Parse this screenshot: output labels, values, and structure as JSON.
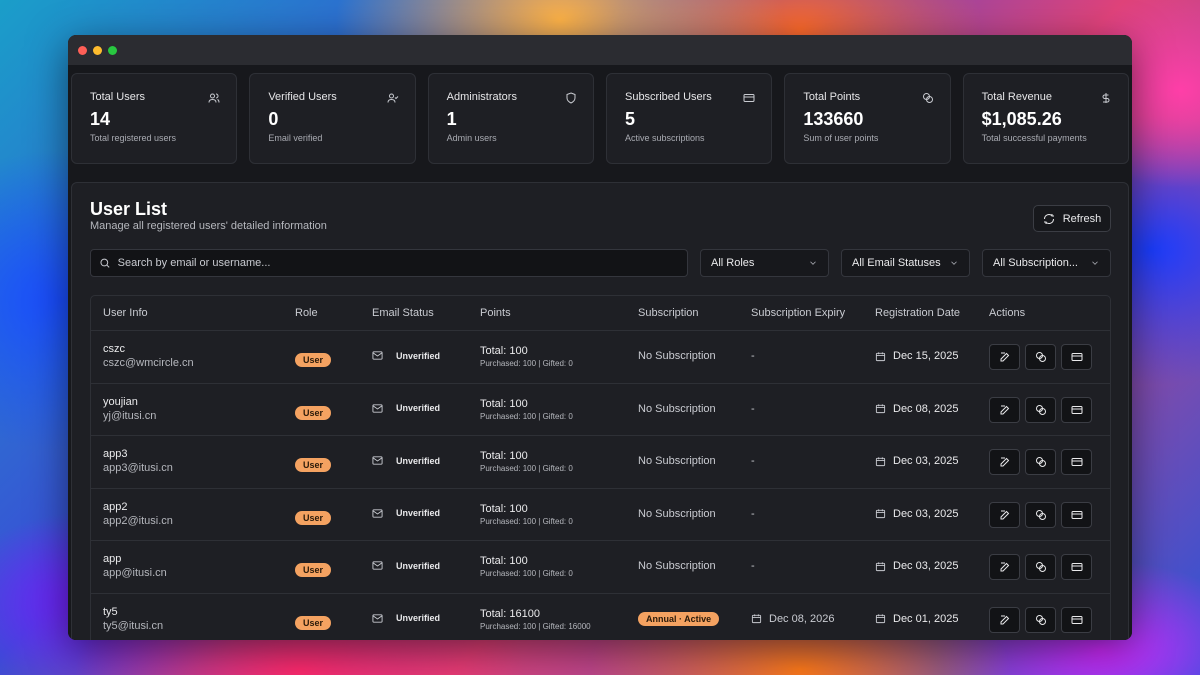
{
  "stats": [
    {
      "title": "Total Users",
      "value": "14",
      "sub": "Total registered users",
      "icon": "users-icon"
    },
    {
      "title": "Verified Users",
      "value": "0",
      "sub": "Email verified",
      "icon": "user-check-icon"
    },
    {
      "title": "Administrators",
      "value": "1",
      "sub": "Admin users",
      "icon": "shield-icon"
    },
    {
      "title": "Subscribed Users",
      "value": "5",
      "sub": "Active subscriptions",
      "icon": "credit-card-icon"
    },
    {
      "title": "Total Points",
      "value": "133660",
      "sub": "Sum of user points",
      "icon": "coins-icon"
    },
    {
      "title": "Total Revenue",
      "value": "$1,085.26",
      "sub": "Total successful payments",
      "icon": "dollar-icon"
    }
  ],
  "panel": {
    "title": "User List",
    "subtitle": "Manage all registered users' detailed information",
    "refresh_label": "Refresh"
  },
  "search": {
    "placeholder": "Search by email or username...",
    "value": ""
  },
  "filters": {
    "roles": "All Roles",
    "email_status": "All Email Statuses",
    "subscription": "All Subscription..."
  },
  "table": {
    "headers": {
      "user_info": "User Info",
      "role": "Role",
      "email_status": "Email Status",
      "points": "Points",
      "subscription": "Subscription",
      "expiry": "Subscription Expiry",
      "registration": "Registration Date",
      "actions": "Actions"
    },
    "rows": [
      {
        "name": "cszc",
        "email": "cszc@wmcircle.cn",
        "role": "User",
        "email_status": "Unverified",
        "points_total": "Total: 100",
        "points_detail": "Purchased: 100 | Gifted: 0",
        "subscription": "No Subscription",
        "expiry": "-",
        "registered": "Dec 15, 2025"
      },
      {
        "name": "youjian",
        "email": "yj@itusi.cn",
        "role": "User",
        "email_status": "Unverified",
        "points_total": "Total: 100",
        "points_detail": "Purchased: 100 | Gifted: 0",
        "subscription": "No Subscription",
        "expiry": "-",
        "registered": "Dec 08, 2025"
      },
      {
        "name": "app3",
        "email": "app3@itusi.cn",
        "role": "User",
        "email_status": "Unverified",
        "points_total": "Total: 100",
        "points_detail": "Purchased: 100 | Gifted: 0",
        "subscription": "No Subscription",
        "expiry": "-",
        "registered": "Dec 03, 2025"
      },
      {
        "name": "app2",
        "email": "app2@itusi.cn",
        "role": "User",
        "email_status": "Unverified",
        "points_total": "Total: 100",
        "points_detail": "Purchased: 100 | Gifted: 0",
        "subscription": "No Subscription",
        "expiry": "-",
        "registered": "Dec 03, 2025"
      },
      {
        "name": "app",
        "email": "app@itusi.cn",
        "role": "User",
        "email_status": "Unverified",
        "points_total": "Total: 100",
        "points_detail": "Purchased: 100 | Gifted: 0",
        "subscription": "No Subscription",
        "expiry": "-",
        "registered": "Dec 03, 2025"
      },
      {
        "name": "ty5",
        "email": "ty5@itusi.cn",
        "role": "User",
        "email_status": "Unverified",
        "points_total": "Total: 16100",
        "points_detail": "Purchased: 100 | Gifted: 16000",
        "subscription": "Annual · Active",
        "expiry": "Dec 08, 2026",
        "registered": "Dec 01, 2025"
      }
    ]
  },
  "colors": {
    "accent_badge": "#f4a261",
    "background": "#17181c",
    "card": "#1e1f24"
  }
}
